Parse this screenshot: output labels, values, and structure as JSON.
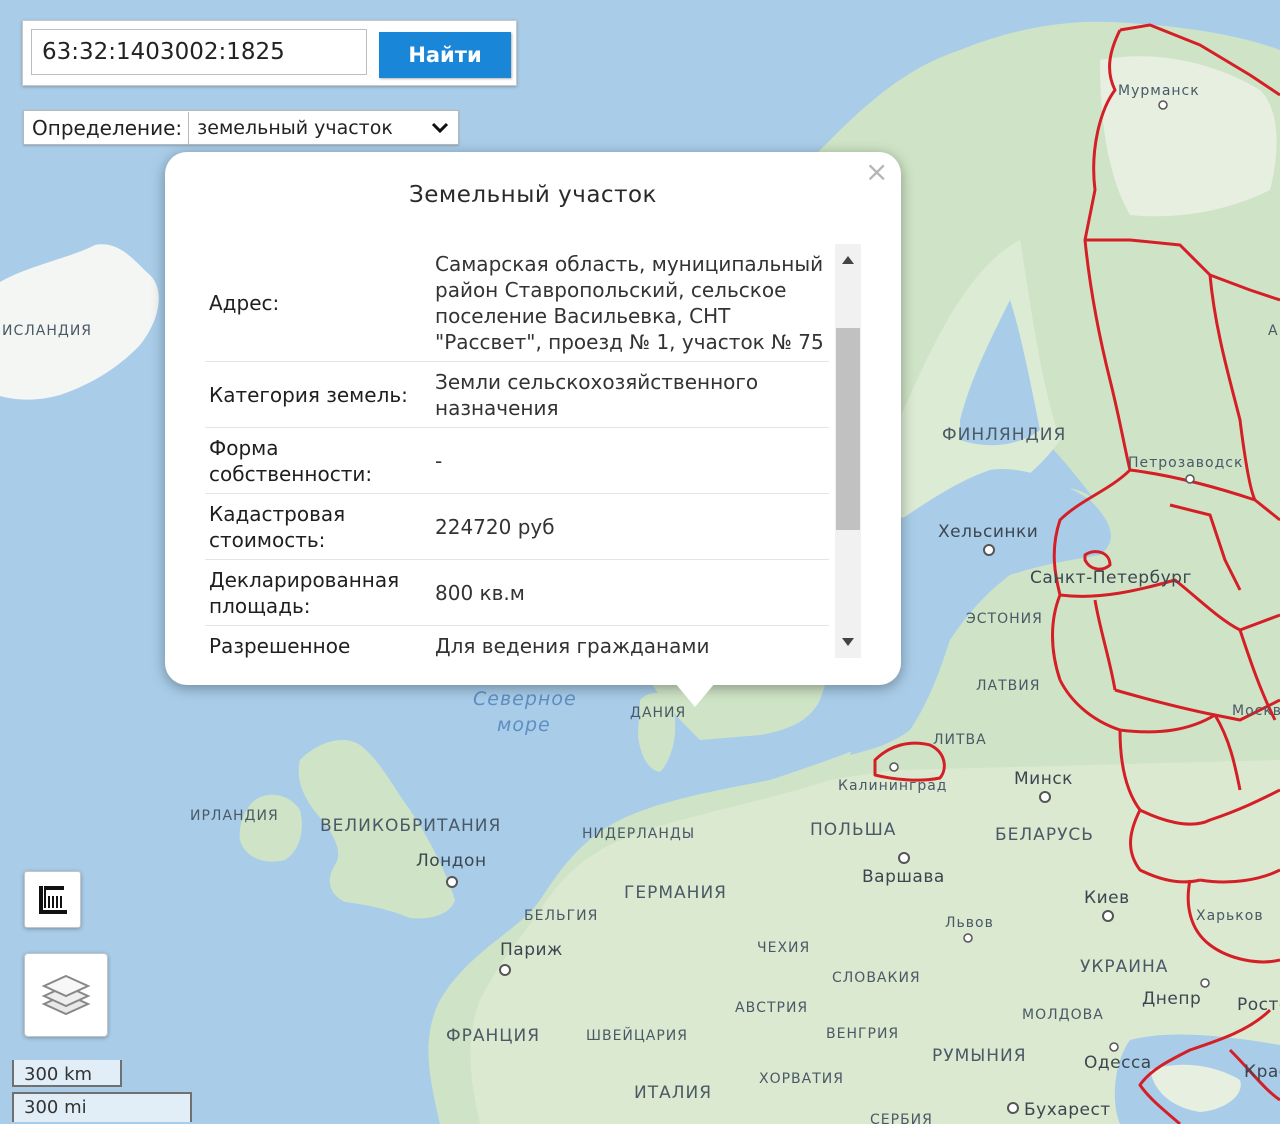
{
  "search": {
    "query": "63:32:1403002:1825",
    "button_label": "Найти"
  },
  "definition": {
    "label": "Определение:",
    "selected": "земельный участок"
  },
  "popup": {
    "title": "Земельный участок",
    "rows": [
      {
        "key": "Адрес:",
        "value": "Самарская область, муниципальный район Ставропольский, сельское поселение Васильевка, СНТ \"Рассвет\", проезд № 1, участок № 75"
      },
      {
        "key": "Категория земель:",
        "value": "Земли сельскохозяйственного назначения"
      },
      {
        "key": "Форма собственности:",
        "value": "-"
      },
      {
        "key": "Кадастровая стоимость:",
        "value": "224720 руб"
      },
      {
        "key": "Декларированная площадь:",
        "value": "800 кв.м"
      },
      {
        "key": "Разрешенное использование:",
        "value": "Для ведения гражданами садоводства и огородничества"
      }
    ]
  },
  "map": {
    "countries": {
      "iceland": "ИСЛАНДИЯ",
      "finland": "ФИНЛЯНДИЯ",
      "estonia": "ЭСТОНИЯ",
      "latvia": "ЛАТВИЯ",
      "lithuania": "ЛИТВА",
      "denmark": "ДАНИЯ",
      "ireland": "ИРЛАНДИЯ",
      "uk": "ВЕЛИКОБРИТАНИЯ",
      "netherlands": "НИДЕРЛАНДЫ",
      "poland": "ПОЛЬША",
      "belarus": "БЕЛАРУСЬ",
      "germany": "ГЕРМАНИЯ",
      "belgium": "БЕЛЬГИЯ",
      "czech": "ЧЕХИЯ",
      "slovakia": "СЛОВАКИЯ",
      "ukraine": "УКРАИНА",
      "austria": "АВСТРИЯ",
      "switzerland": "ШВЕЙЦАРИЯ",
      "hungary": "ВЕНГРИЯ",
      "moldova": "МОЛДОВА",
      "france": "ФРАНЦИЯ",
      "romania": "РУМЫНИЯ",
      "croatia": "ХОРВАТИЯ",
      "italy": "ИТАЛИЯ",
      "serbia": "СЕРБИЯ"
    },
    "cities": {
      "murmansk": "Мурманск",
      "petrozavodsk": "Петрозаводск",
      "helsinki": "Хельсинки",
      "spb": "Санкт-Петербург",
      "kaliningrad": "Калининград",
      "minsk": "Минск",
      "moscow": "Москва",
      "london": "Лондон",
      "warsaw": "Варшава",
      "kyiv": "Киев",
      "lviv": "Львов",
      "paris": "Париж",
      "kharkiv": "Харьков",
      "dnipro": "Днепр",
      "rostov": "Ростов",
      "odessa": "Одесса",
      "krasnodar": "Крас",
      "bucharest": "Бухарест"
    },
    "sea": {
      "line1": "Северное",
      "line2": "море"
    },
    "truncated": {
      "right_edge": "А"
    },
    "scale": {
      "km": "300 km",
      "mi": "300 mi"
    }
  }
}
